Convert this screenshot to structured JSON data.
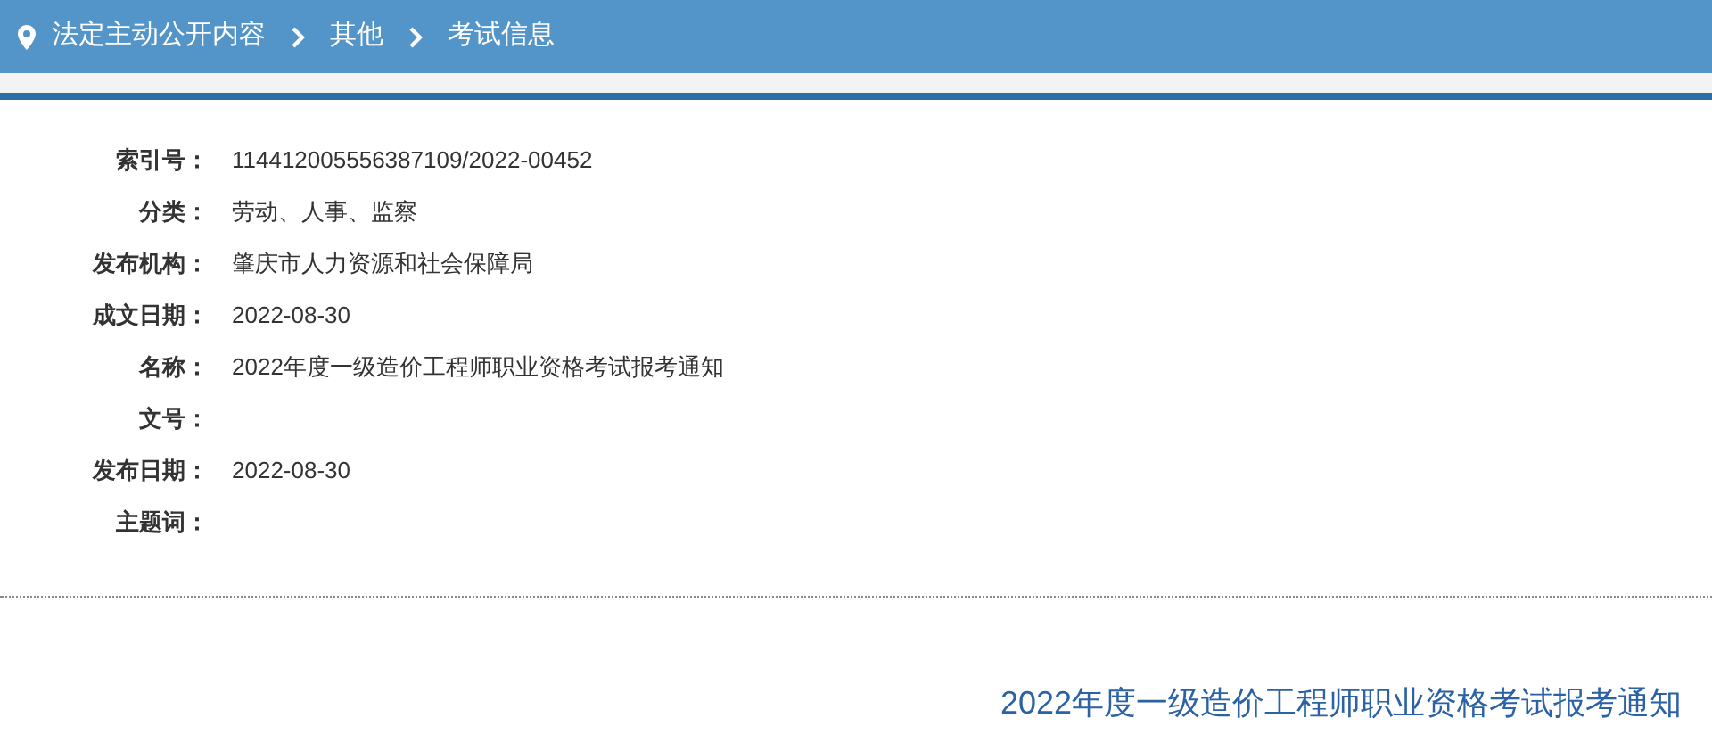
{
  "breadcrumb": [
    {
      "label": "法定主动公开内容"
    },
    {
      "label": "其他"
    },
    {
      "label": "考试信息"
    }
  ],
  "fields": [
    {
      "label": "索引号：",
      "value": "114412005556387109/2022-00452"
    },
    {
      "label": "分类：",
      "value": "劳动、人事、监察"
    },
    {
      "label": "发布机构：",
      "value": "肇庆市人力资源和社会保障局"
    },
    {
      "label": "成文日期：",
      "value": "2022-08-30"
    },
    {
      "label": "名称：",
      "value": "2022年度一级造价工程师职业资格考试报考通知"
    },
    {
      "label": "文号："
    },
    {
      "label": "发布日期：",
      "value": "2022-08-30"
    },
    {
      "label": "主题词："
    }
  ],
  "title": "2022年度一级造价工程师职业资格考试报考通知"
}
